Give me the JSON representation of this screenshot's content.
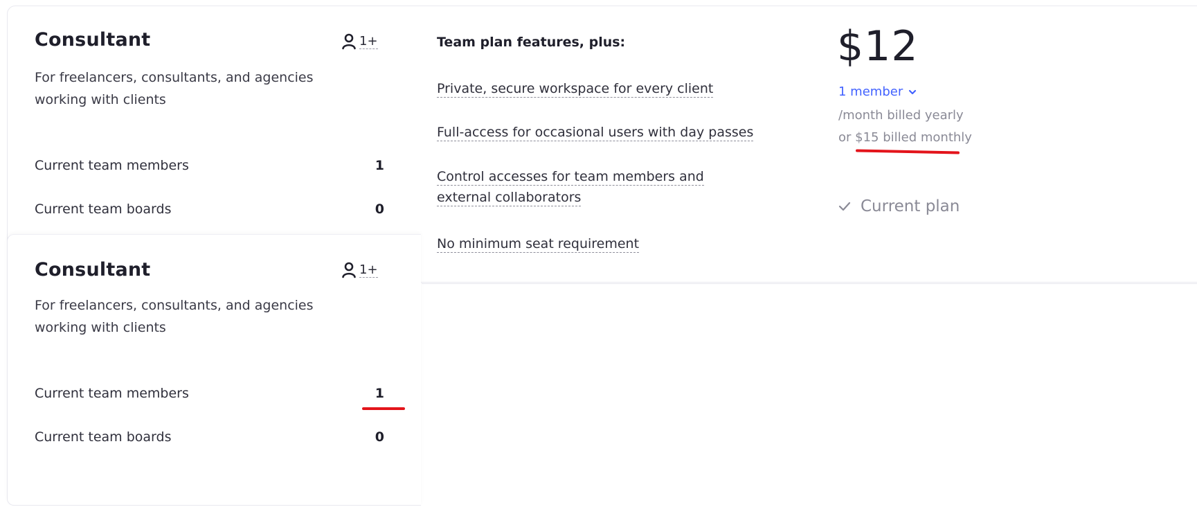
{
  "main_plan": {
    "name": "Consultant",
    "seats": "1+",
    "description": "For freelancers, consultants, and agencies working with clients",
    "stats": [
      {
        "label": "Current team members",
        "value": "1"
      },
      {
        "label": "Current team boards",
        "value": "0"
      }
    ]
  },
  "features": {
    "heading": "Team plan features, plus:",
    "items": [
      "Private, secure workspace for every client",
      "Full-access for occasional users with day passes",
      "Control accesses for team members and external collaborators",
      "No minimum seat requirement"
    ]
  },
  "pricing": {
    "price": "$12",
    "member_select": "1 member",
    "billing_yearly": "/month billed yearly",
    "billing_monthly": "or $15 billed monthly",
    "current_plan": "Current plan"
  },
  "overlay_plan": {
    "name": "Consultant",
    "seats": "1+",
    "description": "For freelancers, consultants, and agencies working with clients",
    "stats": [
      {
        "label": "Current team members",
        "value": "1"
      },
      {
        "label": "Current team boards",
        "value": "0"
      }
    ]
  },
  "colors": {
    "accent": "#4262ff",
    "annotation": "#e3141b",
    "muted": "#8a8a96"
  },
  "icons": [
    "person-icon",
    "chevron-down-icon",
    "check-icon"
  ]
}
